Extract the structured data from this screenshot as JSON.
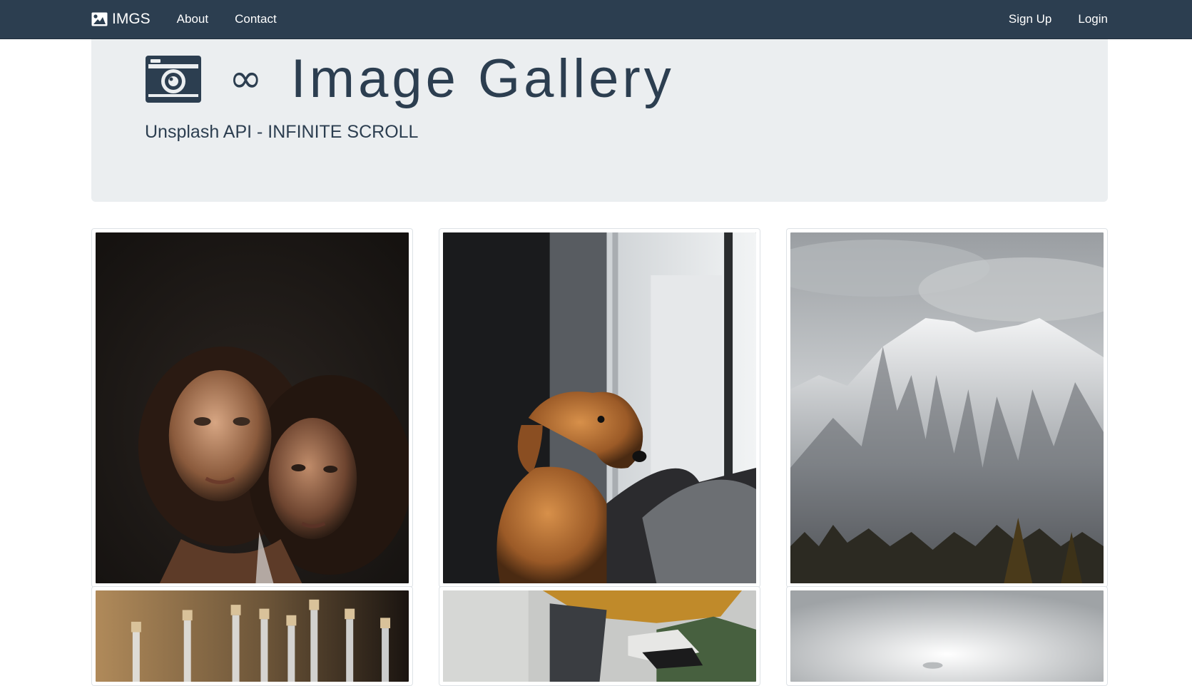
{
  "navbar": {
    "brand_label": "IMGS",
    "brand_icon": "image-icon",
    "links": [
      "About",
      "Contact"
    ],
    "right_links": [
      "Sign Up",
      "Login"
    ]
  },
  "jumbotron": {
    "camera_icon": "camera-icon",
    "infinity_symbol": "∞",
    "title": "Image Gallery",
    "subtitle": "Unsplash API - INFINITE SCROLL"
  },
  "gallery": {
    "photos": [
      {
        "subject": "two-women-portrait"
      },
      {
        "subject": "golden-retriever-window"
      },
      {
        "subject": "snowy-mountain"
      },
      {
        "subject": "glass-bottles"
      },
      {
        "subject": "sneakers-jacket"
      },
      {
        "subject": "foggy-white"
      }
    ]
  },
  "colors": {
    "navbar_bg": "#2c3e50",
    "jumbotron_bg": "#ebeef0",
    "text_primary": "#2c3e50"
  }
}
